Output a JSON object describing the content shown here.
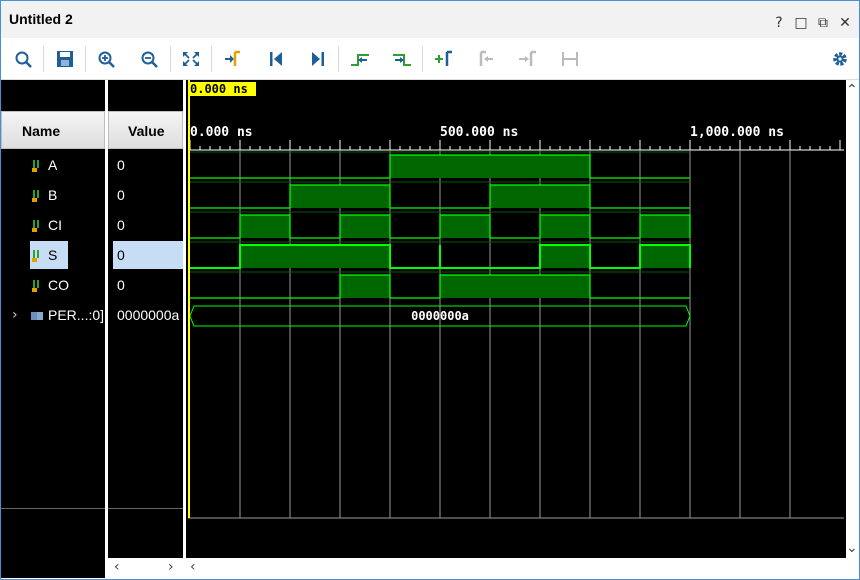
{
  "window": {
    "title": "Untitled 2",
    "buttons": [
      "?",
      "□",
      "⧉",
      "✕"
    ]
  },
  "toolbar": {
    "icons": [
      "search-icon",
      "save-icon",
      "zoom-in-icon",
      "zoom-out-icon",
      "zoom-fit-icon",
      "go-to-cursor-icon",
      "go-to-time-zero-icon",
      "go-to-last-time-icon",
      "previous-transition-icon",
      "next-transition-icon",
      "add-marker-icon",
      "previous-marker-icon",
      "next-marker-icon",
      "swap-cursors-icon",
      "settings-icon"
    ]
  },
  "columns": {
    "name": "Name",
    "value": "Value"
  },
  "signals": [
    {
      "name": "A",
      "value": "0",
      "selected": false,
      "bus": false
    },
    {
      "name": "B",
      "value": "0",
      "selected": false,
      "bus": false
    },
    {
      "name": "CI",
      "value": "0",
      "selected": false,
      "bus": false
    },
    {
      "name": "S",
      "value": "0",
      "selected": true,
      "bus": false
    },
    {
      "name": "CO",
      "value": "0",
      "selected": false,
      "bus": false
    },
    {
      "name": "PER...:0]",
      "value": "0000000a",
      "selected": false,
      "bus": true
    }
  ],
  "waveform": {
    "cursor_time": "0.000 ns",
    "ruler_labels": [
      "0.000 ns",
      "500.000 ns",
      "1,000.000 ns"
    ],
    "bus_value": "0000000a",
    "colors": {
      "signal": "#00ff00",
      "fill": "#006600",
      "cursor": "#ffff00",
      "grid": "#ffffff"
    },
    "time_range_ns": [
      0,
      1000
    ],
    "traces": {
      "A": [
        [
          0,
          0
        ],
        [
          400,
          1
        ],
        [
          800,
          0
        ]
      ],
      "B": [
        [
          0,
          0
        ],
        [
          200,
          1
        ],
        [
          400,
          0
        ],
        [
          600,
          1
        ],
        [
          800,
          0
        ]
      ],
      "CI": [
        [
          0,
          0
        ],
        [
          100,
          1
        ],
        [
          200,
          0
        ],
        [
          300,
          1
        ],
        [
          400,
          0
        ],
        [
          500,
          1
        ],
        [
          600,
          0
        ],
        [
          700,
          1
        ],
        [
          800,
          0
        ],
        [
          900,
          1
        ],
        [
          1000,
          0
        ]
      ],
      "S": [
        [
          0,
          0
        ],
        [
          100,
          1
        ],
        [
          400,
          0
        ],
        [
          500,
          1
        ],
        [
          500,
          0
        ],
        [
          700,
          1
        ],
        [
          800,
          0
        ],
        [
          900,
          1
        ],
        [
          1000,
          0
        ]
      ],
      "CO": [
        [
          0,
          0
        ],
        [
          300,
          1
        ],
        [
          400,
          0
        ],
        [
          500,
          1
        ],
        [
          800,
          0
        ]
      ]
    }
  }
}
